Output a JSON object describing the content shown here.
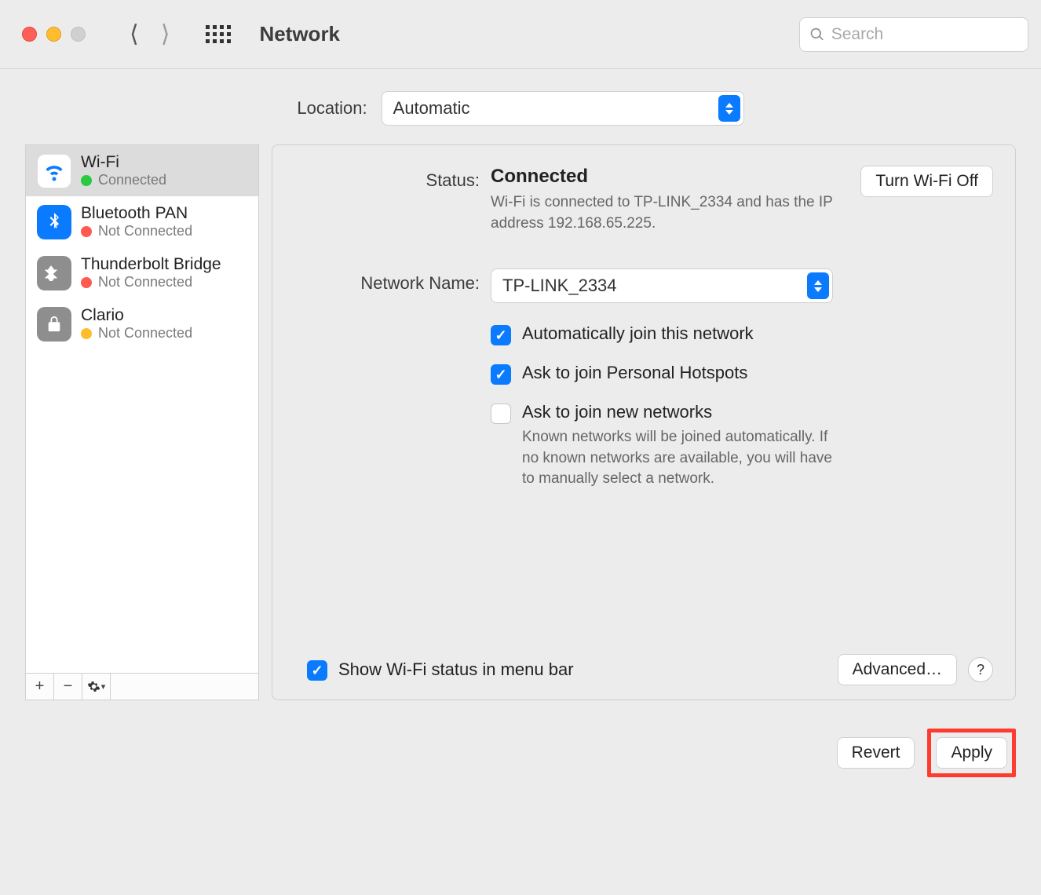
{
  "toolbar": {
    "title": "Network",
    "search_placeholder": "Search"
  },
  "location": {
    "label": "Location:",
    "value": "Automatic"
  },
  "sidebar": {
    "services": [
      {
        "name": "Wi-Fi",
        "status": "Connected",
        "status_color": "green",
        "icon": "wifi",
        "selected": true
      },
      {
        "name": "Bluetooth PAN",
        "status": "Not Connected",
        "status_color": "red",
        "icon": "bluetooth",
        "selected": false
      },
      {
        "name": "Thunderbolt Bridge",
        "status": "Not Connected",
        "status_color": "red",
        "icon": "thunderbolt",
        "selected": false
      },
      {
        "name": "Clario",
        "status": "Not Connected",
        "status_color": "yellow",
        "icon": "lock",
        "selected": false
      }
    ]
  },
  "detail": {
    "status_label": "Status:",
    "status_value": "Connected",
    "wifi_toggle_label": "Turn Wi-Fi Off",
    "status_desc": "Wi-Fi is connected to TP-LINK_2334 and has the IP address 192.168.65.225.",
    "network_name_label": "Network Name:",
    "network_name_value": "TP-LINK_2334",
    "auto_join_label": "Automatically join this network",
    "auto_join_checked": true,
    "ask_hotspot_label": "Ask to join Personal Hotspots",
    "ask_hotspot_checked": true,
    "ask_new_label": "Ask to join new networks",
    "ask_new_checked": false,
    "ask_new_desc": "Known networks will be joined automatically. If no known networks are available, you will have to manually select a network.",
    "show_menu_label": "Show Wi-Fi status in menu bar",
    "show_menu_checked": true,
    "advanced_label": "Advanced…"
  },
  "footer": {
    "revert_label": "Revert",
    "apply_label": "Apply"
  }
}
